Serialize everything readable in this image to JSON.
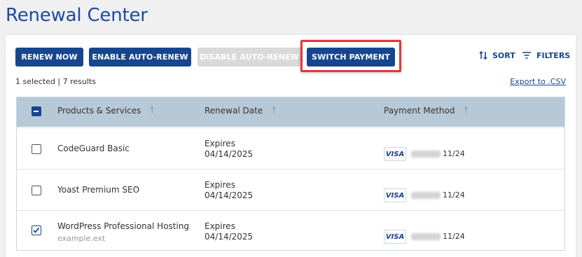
{
  "page": {
    "title": "Renewal Center"
  },
  "toolbar": {
    "renew_now": "RENEW NOW",
    "enable_auto_renew": "ENABLE AUTO-RENEW",
    "disable_auto_renew": "DISABLE AUTO-RENEW",
    "switch_payment": "SWITCH PAYMENT",
    "sort": "SORT",
    "filters": "FILTERS"
  },
  "status": {
    "selection": "1 selected | 7 results",
    "export": "Export to .CSV"
  },
  "table": {
    "columns": [
      "Products & Services",
      "Renewal Date",
      "Payment Method"
    ],
    "rows": [
      {
        "name": "CodeGuard Basic",
        "sub": "",
        "date_label": "Expires",
        "date": "04/14/2025",
        "card": "VISA",
        "expiry": "11/24",
        "checked": false
      },
      {
        "name": "Yoast Premium SEO",
        "sub": "",
        "date_label": "Expires",
        "date": "04/14/2025",
        "card": "VISA",
        "expiry": "11/24",
        "checked": false
      },
      {
        "name": "WordPress Professional Hosting",
        "sub": "example.ext",
        "date_label": "Expires",
        "date": "04/14/2025",
        "card": "VISA",
        "expiry": "11/24",
        "checked": true
      }
    ]
  },
  "colors": {
    "accent": "#17468f",
    "title": "#1e4aa0",
    "highlight": "#e8353b",
    "header_bg": "#b7c8d6"
  }
}
